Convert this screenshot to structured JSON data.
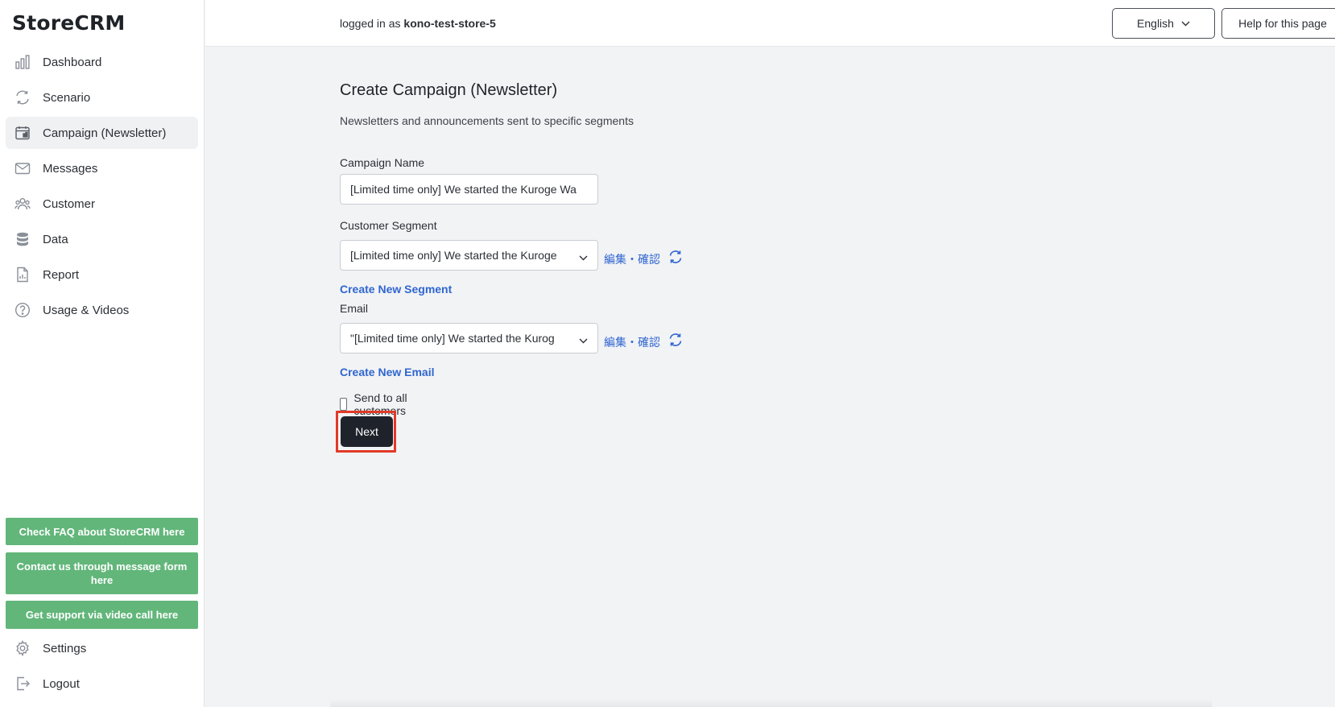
{
  "app": {
    "name": "StoreCRM"
  },
  "sidebar": {
    "items": [
      {
        "label": "Dashboard",
        "icon": "bar-chart-icon"
      },
      {
        "label": "Scenario",
        "icon": "cycle-icon"
      },
      {
        "label": "Campaign (Newsletter)",
        "icon": "calendar-icon",
        "active": true
      },
      {
        "label": "Messages",
        "icon": "envelope-icon"
      },
      {
        "label": "Customer",
        "icon": "users-icon"
      },
      {
        "label": "Data",
        "icon": "database-icon"
      },
      {
        "label": "Report",
        "icon": "report-icon"
      },
      {
        "label": "Usage & Videos",
        "icon": "question-icon"
      }
    ],
    "support_buttons": {
      "faq": "Check FAQ about StoreCRM here",
      "contact": "Contact us through message form here",
      "video_call": "Get support via video call here"
    },
    "bottom_items": [
      {
        "label": "Settings",
        "icon": "gear-icon"
      },
      {
        "label": "Logout",
        "icon": "logout-icon"
      }
    ],
    "support_color": "#62b67a"
  },
  "header": {
    "logged_in_prefix": "logged in as",
    "store_name": "kono-test-store-5",
    "language": "English",
    "help_label": "Help for this page"
  },
  "form": {
    "title": "Create Campaign (Newsletter)",
    "description": "Newsletters and announcements sent to specific segments",
    "campaign_name_label": "Campaign Name",
    "campaign_name_value": "[Limited time only] We started the Kuroge Wa",
    "segment_label": "Customer Segment",
    "segment_value": "[Limited time only] We started the Kuroge",
    "segment_edit_link": "編集・確認",
    "create_segment_link": "Create New Segment",
    "email_label": "Email",
    "email_value": "\"[Limited time only] We started the Kurog",
    "email_edit_link": "編集・確認",
    "create_email_link": "Create New Email",
    "send_all_label": "Send to all customers",
    "send_all_checked": false,
    "next_label": "Next"
  },
  "colors": {
    "link": "#2f66d0",
    "primary_button": "#1e232b",
    "highlight": "#e23a26"
  }
}
